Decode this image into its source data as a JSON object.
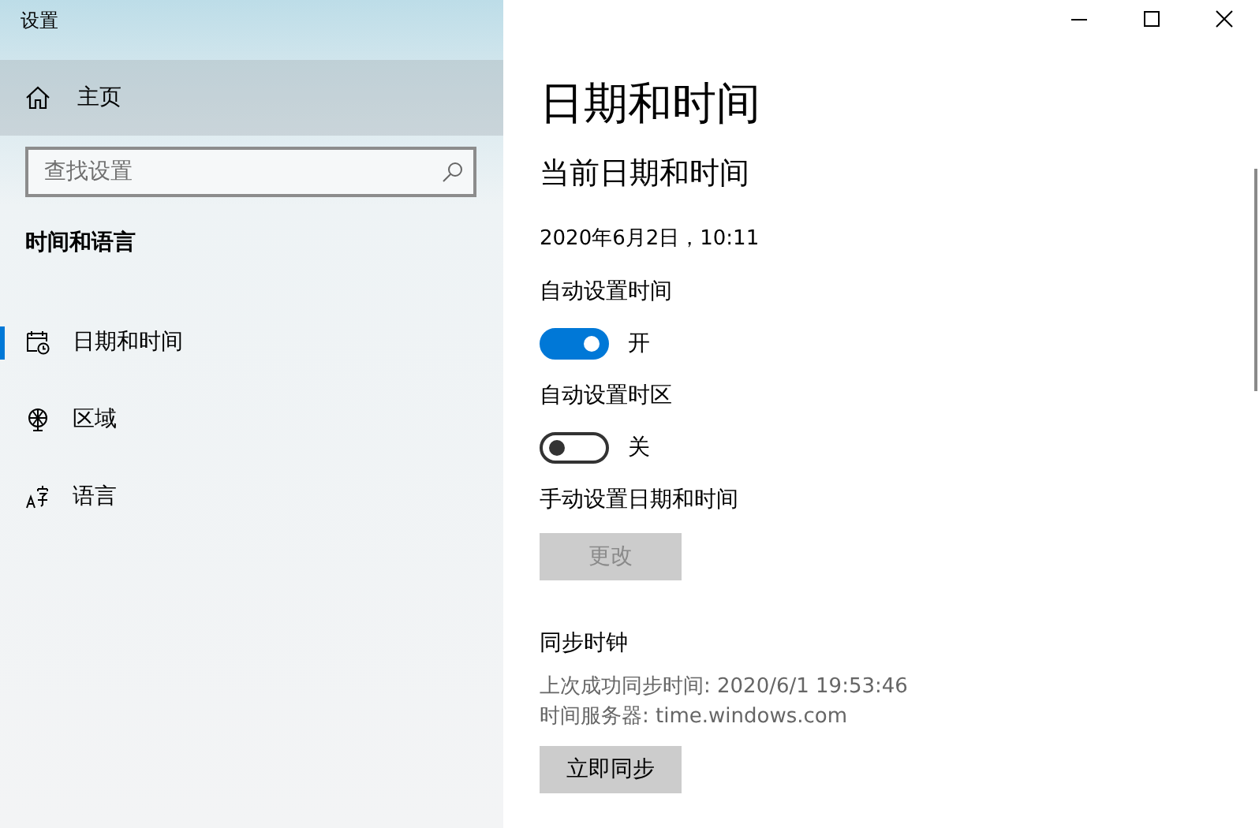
{
  "window": {
    "title": "设置",
    "controls": [
      {
        "kind": "minimize"
      },
      {
        "kind": "maximize"
      },
      {
        "kind": "close"
      }
    ]
  },
  "sidebar": {
    "home": {
      "label": "主页",
      "hovered": true
    },
    "search": {
      "placeholder": "查找设置"
    },
    "category": "时间和语言",
    "items": [
      {
        "label": "日期和时间",
        "kind": "calendar",
        "selected": true
      },
      {
        "label": "区域",
        "kind": "globe",
        "selected": false
      },
      {
        "label": "语言",
        "kind": "language",
        "selected": false
      }
    ]
  },
  "content": {
    "title": "日期和时间",
    "subtitle": "当前日期和时间",
    "current": "2020年6月2日，10:11",
    "settings": [
      {
        "label": "自动设置时间",
        "on": true,
        "state_label": "开"
      },
      {
        "label": "自动设置时区",
        "on": false,
        "state_label": "关"
      }
    ],
    "manual": {
      "label": "手动设置日期和时间",
      "button": "更改",
      "disabled": true
    },
    "sync": {
      "heading": "同步时钟",
      "last_sync": "上次成功同步时间: 2020/6/1 19:53:46",
      "server": "时间服务器: time.windows.com",
      "button": "立即同步",
      "disabled": false
    }
  }
}
